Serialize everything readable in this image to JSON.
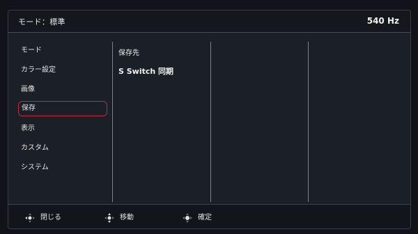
{
  "header": {
    "title": "モード：標準",
    "refresh": "540 Hz"
  },
  "menu": {
    "items": [
      {
        "label": "モード"
      },
      {
        "label": "カラー設定"
      },
      {
        "label": "画像"
      },
      {
        "label": "保存"
      },
      {
        "label": "表示"
      },
      {
        "label": "カスタム"
      },
      {
        "label": "システム"
      }
    ],
    "selected": "保存"
  },
  "submenu": {
    "items": [
      {
        "label": "保存先"
      },
      {
        "label": "S Switch 同期"
      }
    ]
  },
  "footer": {
    "items": [
      {
        "label": "閉じる",
        "icon": "joystick-left-icon"
      },
      {
        "label": "移動",
        "icon": "joystick-updown-icon"
      },
      {
        "label": "確定",
        "icon": "joystick-center-icon"
      }
    ]
  },
  "colors": {
    "accent": "#c2264a",
    "background": "#1b1f26",
    "text": "#e6e6e6"
  }
}
